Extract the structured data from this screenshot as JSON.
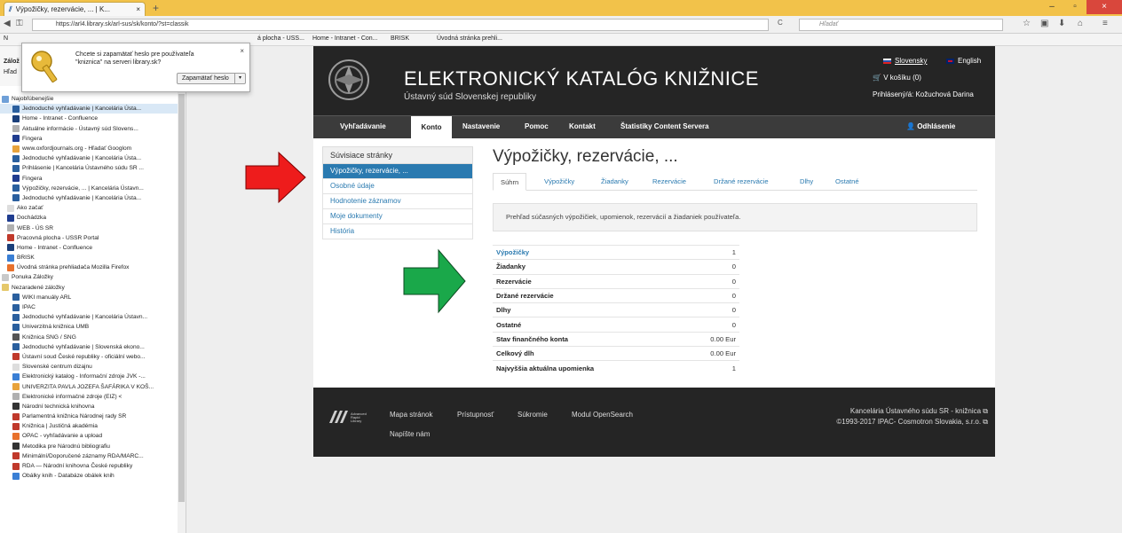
{
  "browser": {
    "tab_title": "Výpožičky, rezervácie, ... | K...",
    "tab_close": "×",
    "new_tab": "+",
    "url": "https://arl4.library.sk/arl-sus/sk/konto/?st=classik",
    "search_placeholder": "Hľadať",
    "win_min": "–",
    "win_max": "▫",
    "win_close": "×"
  },
  "bookmark_bar": {
    "items": [
      "N",
      "á plocha - USS...",
      "Home - Intranet - Con...",
      "BRISK",
      "Úvodná stránka prehli..."
    ]
  },
  "password_popup": {
    "message": "Chcete si zapamätať heslo pre používateľa \"kniznica\" na serveri library.sk?",
    "close": "×",
    "button_label": "Zapamätať heslo",
    "button_arrow": "▾"
  },
  "sidebar": {
    "head_label": "Zálož",
    "search_label": "Hľad",
    "items": [
      {
        "label": "Najobľúbenejšie",
        "color": "#6fa0d8",
        "indent": 2
      },
      {
        "label": "Jednoduché vyhľadávanie | Kancelária Ústa...",
        "color": "#2a5f9e",
        "indent": 14,
        "selected": true
      },
      {
        "label": "Home - Intranet - Confluence",
        "color": "#1a3f7a",
        "indent": 14
      },
      {
        "label": "Aktuálne informácie - Ústavný súd Slovens...",
        "color": "#b0b0b0",
        "indent": 14
      },
      {
        "label": "Fingera",
        "color": "#1f3c8f",
        "indent": 14
      },
      {
        "label": "www.oxfordjournals.org - Hľadať Googlom",
        "color": "#e8a33c",
        "indent": 14
      },
      {
        "label": "Jednoduché vyhľadávanie | Kancelária Ústa...",
        "color": "#2a5f9e",
        "indent": 14
      },
      {
        "label": "Prihlásenie | Kancelária Ústavného súdu SR ...",
        "color": "#2a5f9e",
        "indent": 14
      },
      {
        "label": "Fingera",
        "color": "#1f3c8f",
        "indent": 14
      },
      {
        "label": "Výpožičky, rezervácie, ... | Kancelária Ústavn...",
        "color": "#2a5f9e",
        "indent": 14
      },
      {
        "label": "Jednoduché vyhľadávanie | Kancelária Ústa...",
        "color": "#2a5f9e",
        "indent": 14
      },
      {
        "label": "Ako začať",
        "color": "#dddddd",
        "indent": 8
      },
      {
        "label": "Dochádzka",
        "color": "#1f3c8f",
        "indent": 8
      },
      {
        "label": "WEB - ÚS SR",
        "color": "#b0b0b0",
        "indent": 8
      },
      {
        "label": "Pracovná plocha - USSR Portal",
        "color": "#c0392b",
        "indent": 8
      },
      {
        "label": "Home - Intranet - Confluence",
        "color": "#1a3f7a",
        "indent": 8
      },
      {
        "label": "BRISK",
        "color": "#3a7fd5",
        "indent": 8
      },
      {
        "label": "Úvodná stránka prehliadača Mozilla Firefox",
        "color": "#e8712c",
        "indent": 8
      },
      {
        "label": "Ponuka Záložky",
        "color": "#c9c9c9",
        "indent": 2
      },
      {
        "label": "Nezaradené záložky",
        "color": "#e5c86a",
        "indent": 2
      },
      {
        "label": "WIKI manuály ARL",
        "color": "#2a5f9e",
        "indent": 14
      },
      {
        "label": "IPAC",
        "color": "#2a5f9e",
        "indent": 14
      },
      {
        "label": "Jednoduché vyhľadávanie | Kancelária Ústavn...",
        "color": "#2a5f9e",
        "indent": 14
      },
      {
        "label": "Univerzitná knižnica UMB",
        "color": "#2a5f9e",
        "indent": 14
      },
      {
        "label": "Knižnica SNG / SNG",
        "color": "#555555",
        "indent": 14
      },
      {
        "label": "Jednoduché vyhľadávanie | Slovenská ekono...",
        "color": "#2a5f9e",
        "indent": 14
      },
      {
        "label": "Ústavní soud České republiky - oficiální webo...",
        "color": "#c0392b",
        "indent": 14
      },
      {
        "label": "Slovenské centrum dizajnu",
        "color": "#dddddd",
        "indent": 14
      },
      {
        "label": "Elektronický katalog - Informační zdroje JVK -...",
        "color": "#3a7fd5",
        "indent": 14
      },
      {
        "label": "UNIVERZITA PAVLA JOZEFA ŠAFÁRIKA V KOŠ...",
        "color": "#e8a33c",
        "indent": 14
      },
      {
        "label": "Elektronické informačné zdroje (EIZ) <",
        "color": "#b0b0b0",
        "indent": 14
      },
      {
        "label": "Národní technická knihovna",
        "color": "#333333",
        "indent": 14
      },
      {
        "label": "Parlamentná knižnica Národnej rady SR",
        "color": "#c0392b",
        "indent": 14
      },
      {
        "label": "Knižnica | Justičná akadémia",
        "color": "#c0392b",
        "indent": 14
      },
      {
        "label": "OPAC - vyhľadávanie a upload",
        "color": "#e8712c",
        "indent": 14
      },
      {
        "label": "Metodika pre Národnú bibliografiu",
        "color": "#333333",
        "indent": 14
      },
      {
        "label": "Minimální/Doporučené záznamy RDA/MARC...",
        "color": "#c0392b",
        "indent": 14
      },
      {
        "label": "RDA — Národní knihovna České republiky",
        "color": "#c0392b",
        "indent": 14
      },
      {
        "label": "Obálky knih - Databáze obálek knih",
        "color": "#3a7fd5",
        "indent": 14
      }
    ]
  },
  "header": {
    "title": "ELEKTRONICKÝ KATALÓG KNIŽNICE",
    "subtitle": "Ústavný súd Slovenskej republiky",
    "lang_sk": "Slovensky",
    "lang_en": "English",
    "cart": "V košíku (0)",
    "logged_in": "Prihlásený/á: Kožuchová Darina"
  },
  "menu": {
    "items": [
      "Vyhľadávanie",
      "Konto",
      "Nastavenie",
      "Pomoc",
      "Kontakt",
      "Štatistiky Content Servera"
    ],
    "logout": "Odhlásenie"
  },
  "left_menu": {
    "head": "Súvisiace stránky",
    "items": [
      "Výpožičky, rezervácie, ...",
      "Osobné údaje",
      "Hodnotenie záznamov",
      "Moje dokumenty",
      "História"
    ]
  },
  "main": {
    "title": "Výpožičky, rezervácie, ...",
    "tabs": [
      "Súhrn",
      "Výpožičky",
      "Žiadanky",
      "Rezervácie",
      "Držané rezervácie",
      "Dlhy",
      "Ostatné"
    ],
    "overview": "Prehľad súčasných výpožičiek, upomienok, rezervácií a žiadaniek používateľa.",
    "summary": [
      {
        "label": "Výpožičky",
        "value": "1"
      },
      {
        "label": "Žiadanky",
        "value": "0"
      },
      {
        "label": "Rezervácie",
        "value": "0"
      },
      {
        "label": "Držané rezervácie",
        "value": "0"
      },
      {
        "label": "Dlhy",
        "value": "0"
      },
      {
        "label": "Ostatné",
        "value": "0"
      },
      {
        "label": "Stav finančného konta",
        "value": "0.00 Eur"
      },
      {
        "label": "Celkový dlh",
        "value": "0.00 Eur"
      },
      {
        "label": "Najvyššia aktuálna upomienka",
        "value": "1"
      }
    ]
  },
  "footer": {
    "links": [
      "Mapa stránok",
      "Prístupnosť",
      "Súkromie",
      "Modul OpenSearch"
    ],
    "write": "Napíšte nám",
    "right1": "Kancelária Ústavného súdu SR - knižnica",
    "right2": "©1993-2017 IPAC- Cosmotron Slovakia, s.r.o."
  },
  "colors": {
    "arrow_red": "#ee1c1c",
    "arrow_green": "#1aa84a",
    "link_blue": "#2a7ab0",
    "header_dark": "#252525"
  }
}
